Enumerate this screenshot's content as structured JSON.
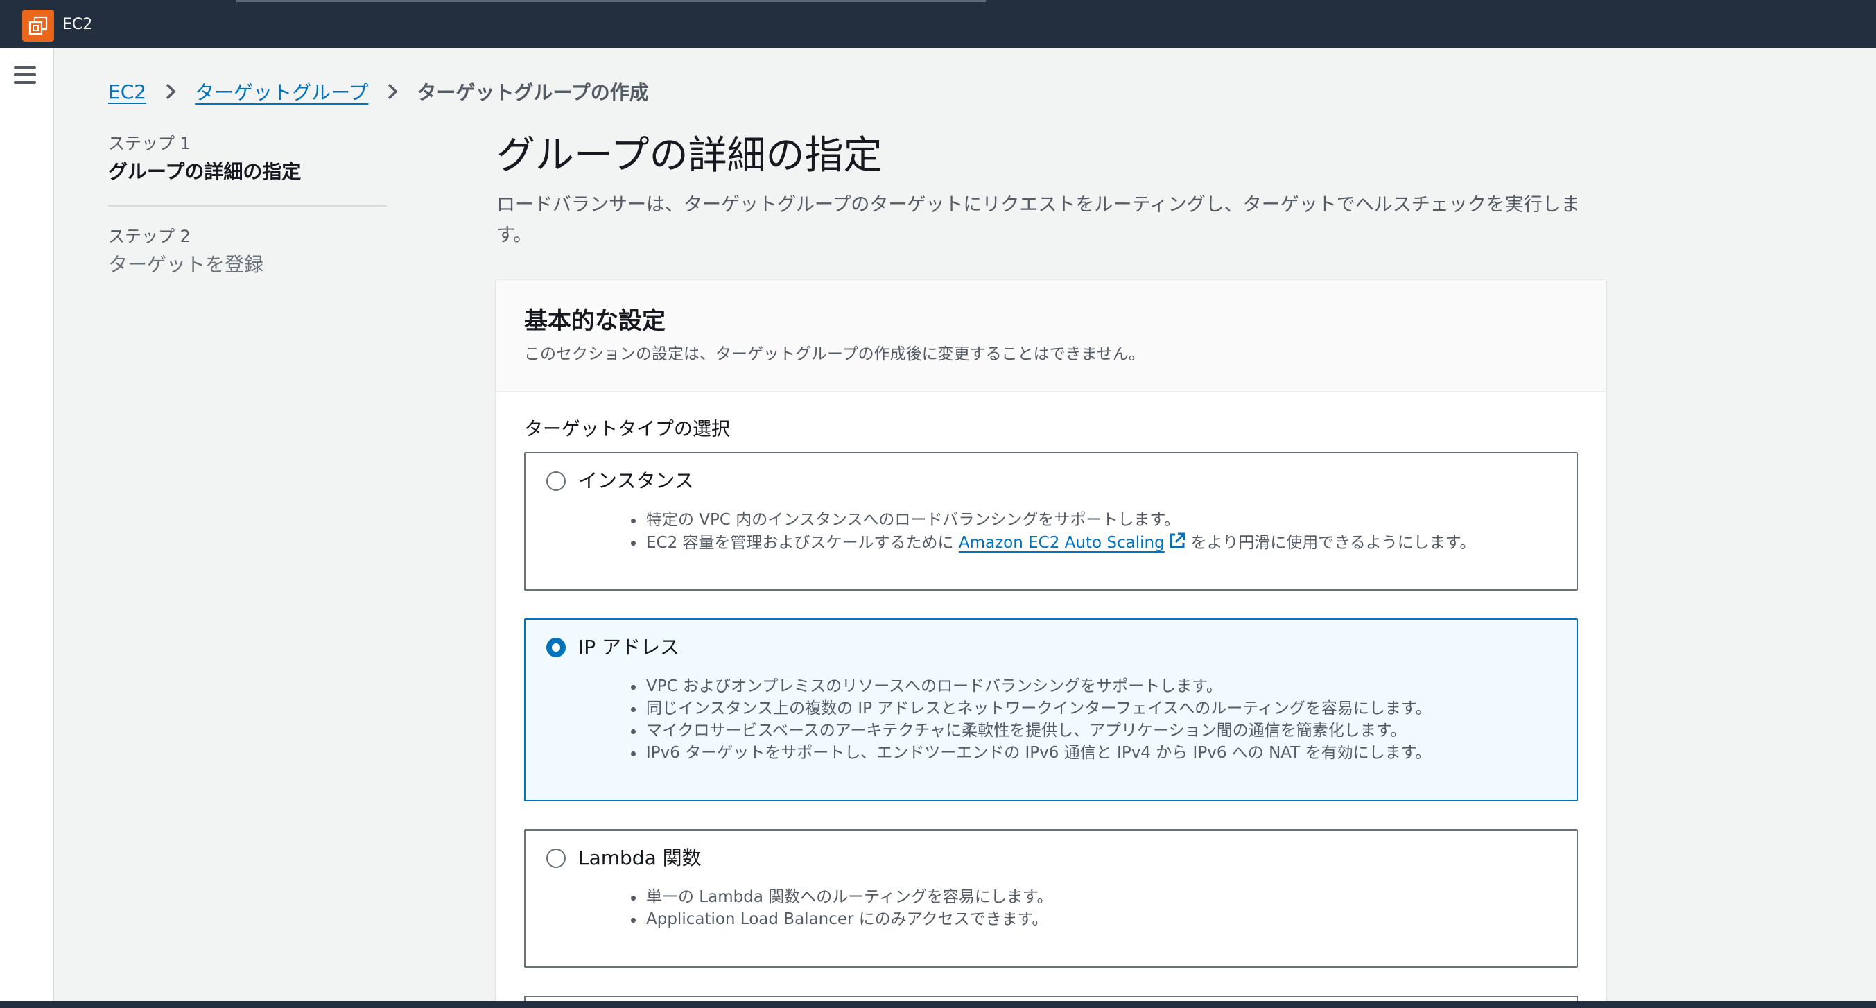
{
  "header": {
    "app_name": "EC2",
    "icon": "ec2-service-icon"
  },
  "nav": {
    "menu_icon": "hamburger-menu-icon"
  },
  "breadcrumb": {
    "items": [
      "EC2",
      "ターゲットグループ"
    ],
    "current": "ターゲットグループの作成",
    "separator_icon": "chevron-right-icon"
  },
  "steps": [
    {
      "number": "ステップ 1",
      "title": "グループの詳細の指定",
      "active": true
    },
    {
      "number": "ステップ 2",
      "title": "ターゲットを登録",
      "active": false
    }
  ],
  "main": {
    "title": "グループの詳細の指定",
    "description": "ロードバランサーは、ターゲットグループのターゲットにリクエストをルーティングし、ターゲットでヘルスチェックを実行します。"
  },
  "panel": {
    "title": "基本的な設定",
    "subtitle": "このセクションの設定は、ターゲットグループの作成後に変更することはできません。",
    "field_label": "ターゲットタイプの選択",
    "options": [
      {
        "label": "インスタンス",
        "selected": false,
        "bullets": [
          "特定の VPC 内のインスタンスへのロードバランシングをサポートします。"
        ],
        "bullet_link": {
          "before": "EC2 容量を管理およびスケールするために",
          "link": "Amazon EC2 Auto Scaling",
          "after": "をより円滑に使用できるようにします。",
          "icon": "external-link-icon"
        }
      },
      {
        "label": "IP アドレス",
        "selected": true,
        "bullets": [
          "VPC およびオンプレミスのリソースへのロードバランシングをサポートします。",
          "同じインスタンス上の複数の IP アドレスとネットワークインターフェイスへのルーティングを容易にします。",
          "マイクロサービスベースのアーキテクチャに柔軟性を提供し、アプリケーション間の通信を簡素化します。",
          "IPv6 ターゲットをサポートし、エンドツーエンドの IPv6 通信と IPv4 から IPv6 への NAT を有効にします。"
        ]
      },
      {
        "label": "Lambda 関数",
        "selected": false,
        "bullets": [
          "単一の Lambda 関数へのルーティングを容易にします。",
          "Application Load Balancer にのみアクセスできます。"
        ]
      }
    ]
  },
  "colors": {
    "accent": "#0073bb",
    "topbar": "#232f3e",
    "brand_orange": "#e9661b"
  }
}
